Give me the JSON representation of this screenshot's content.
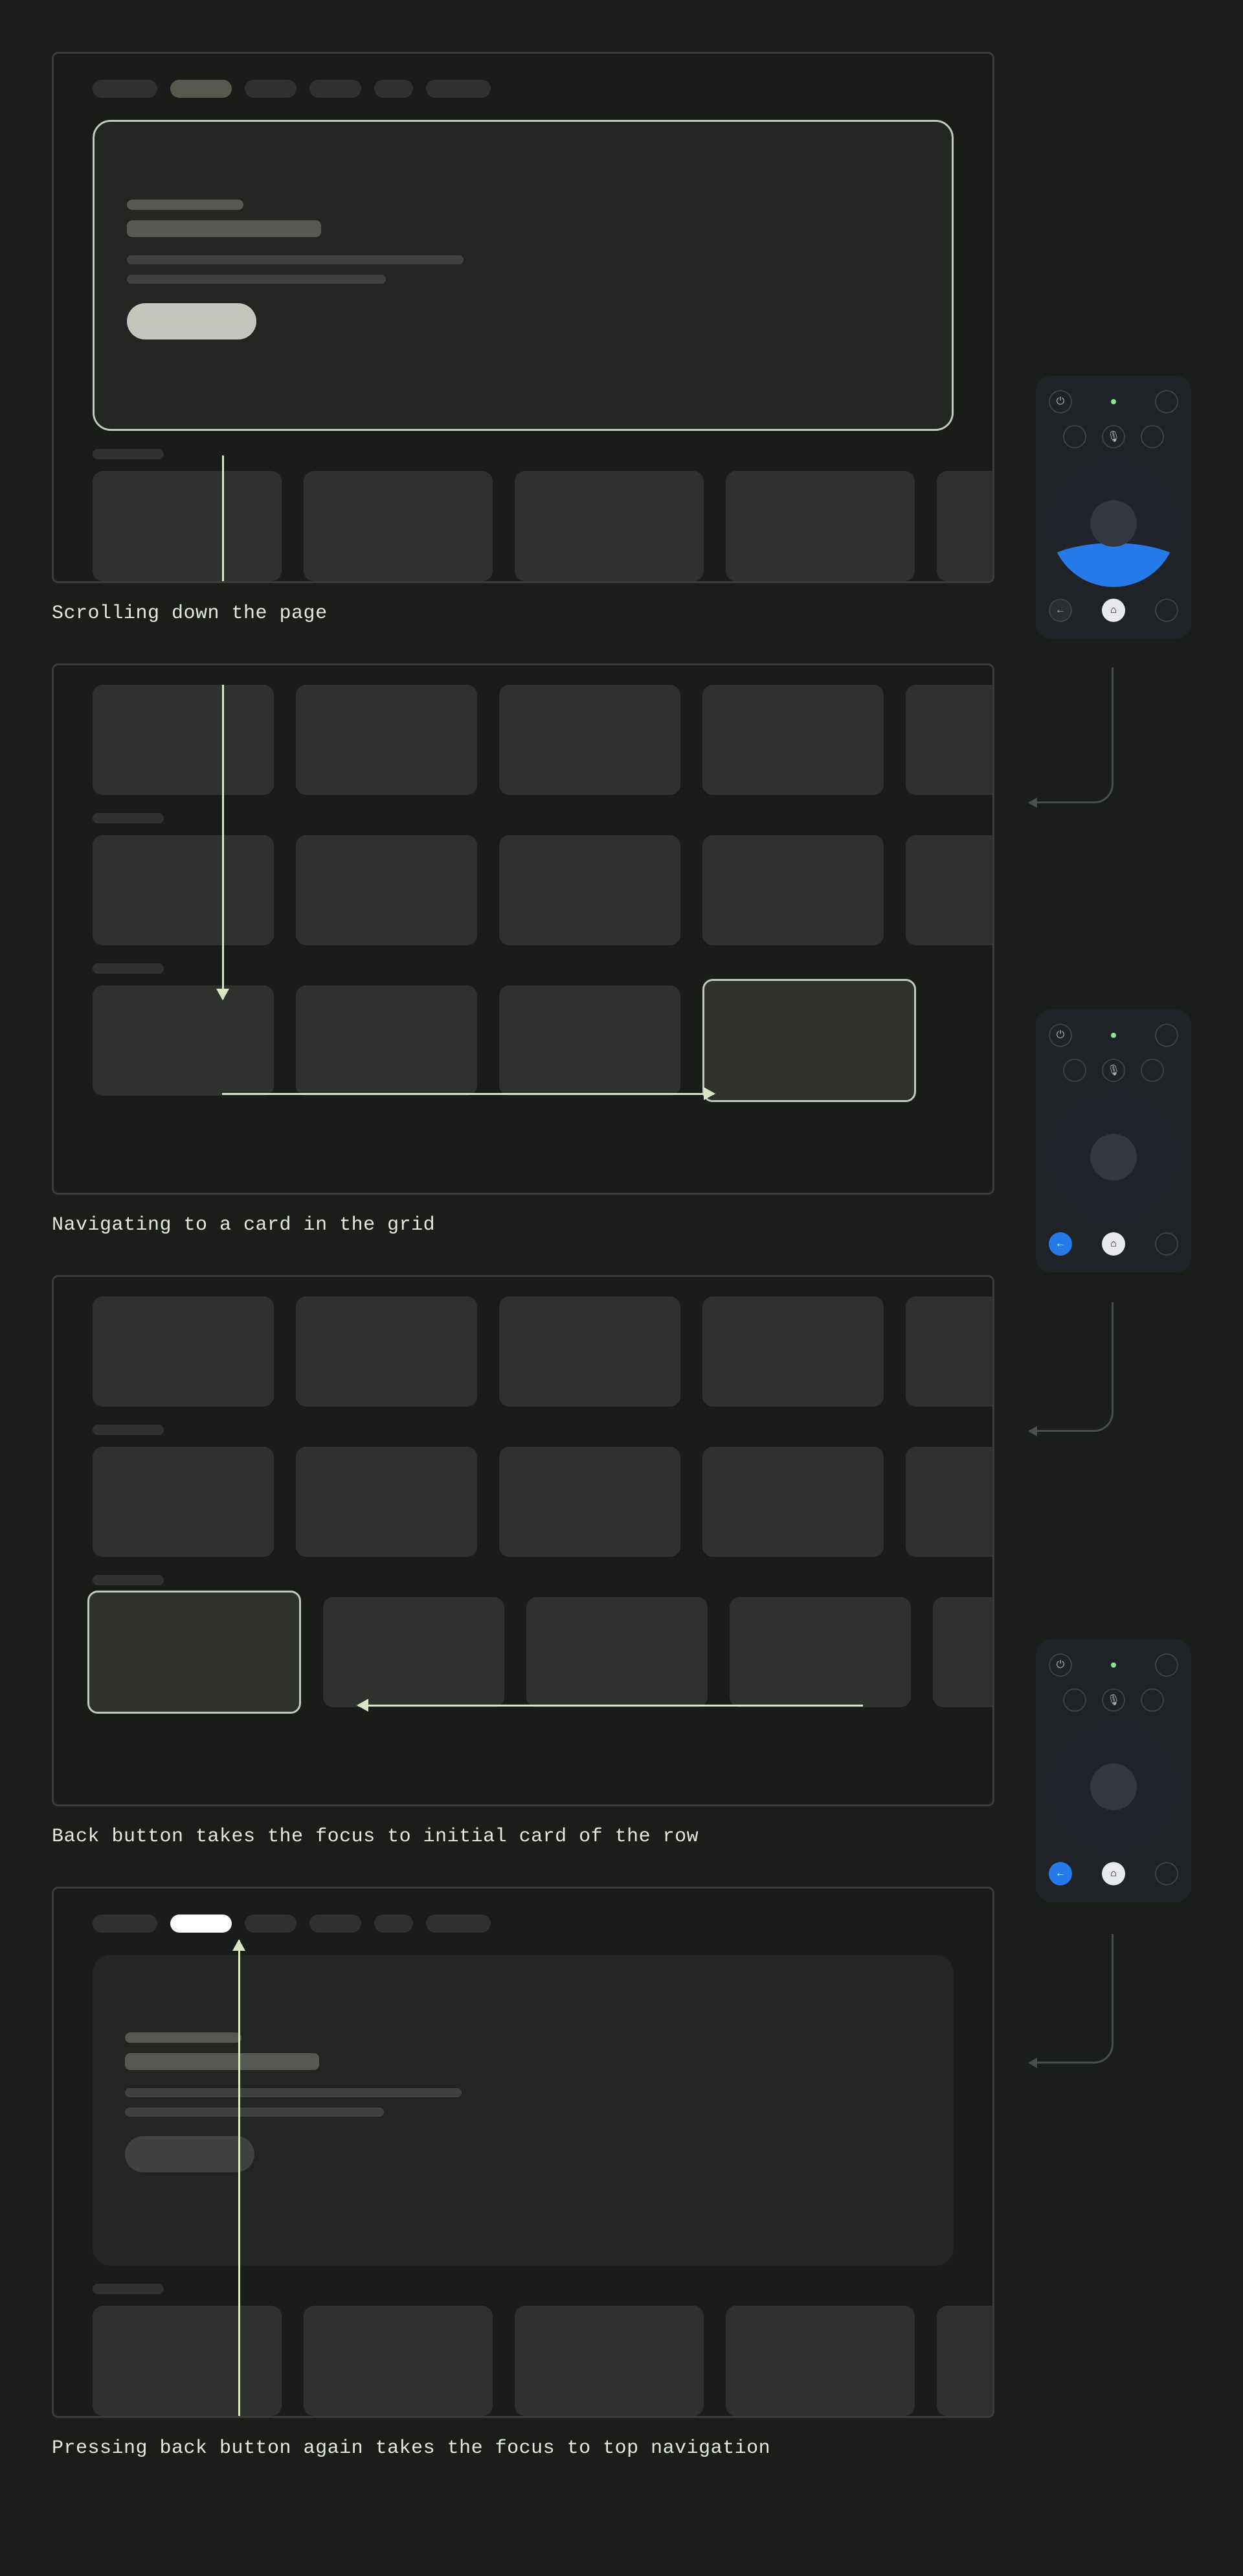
{
  "captions": {
    "c1": "Scrolling down the page",
    "c2": "Navigating to a card in the grid",
    "c3": "Back button takes the focus to initial card of the row",
    "c4": "Pressing back button again takes the focus to top navigation"
  },
  "remote_icons": {
    "power": "⏻",
    "mic": "🎙",
    "back": "←",
    "home": "⌂"
  }
}
